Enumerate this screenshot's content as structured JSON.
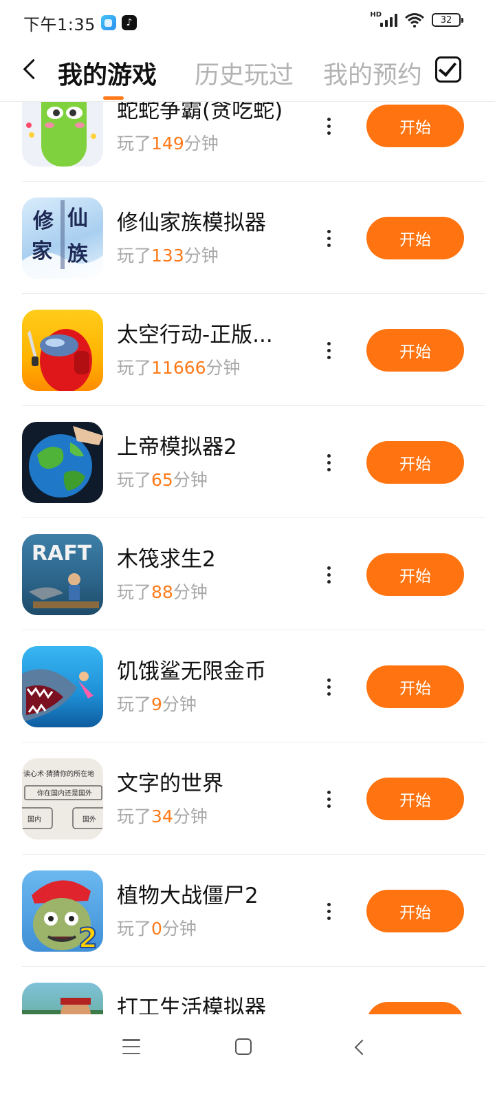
{
  "status_bar": {
    "time": "下午1:35",
    "hd_label": "HD",
    "battery": "32",
    "app_icons": [
      "message-app-icon",
      "tiktok-icon"
    ]
  },
  "header": {
    "tabs": [
      {
        "label": "我的游戏",
        "active": true
      },
      {
        "label": "历史玩过",
        "active": false
      },
      {
        "label": "我的预约",
        "active": false
      }
    ],
    "accent_color": "#ff7a1a"
  },
  "games": [
    {
      "title": "蛇蛇争霸(贪吃蛇)",
      "played_prefix": "玩了",
      "minutes": "149",
      "played_suffix": "分钟",
      "button": "开始",
      "icon": "snake-game-icon"
    },
    {
      "title": "修仙家族模拟器",
      "played_prefix": "玩了",
      "minutes": "133",
      "played_suffix": "分钟",
      "button": "开始",
      "icon": "cultivation-game-icon",
      "icon_text": "修仙家族"
    },
    {
      "title": "太空行动-正版...",
      "played_prefix": "玩了",
      "minutes": "11666",
      "played_suffix": "分钟",
      "button": "开始",
      "icon": "space-crewmate-icon"
    },
    {
      "title": "上帝模拟器2",
      "played_prefix": "玩了",
      "minutes": "65",
      "played_suffix": "分钟",
      "button": "开始",
      "icon": "earth-globe-icon"
    },
    {
      "title": "木筏求生2",
      "played_prefix": "玩了",
      "minutes": "88",
      "played_suffix": "分钟",
      "button": "开始",
      "icon": "raft-game-icon",
      "icon_text": "RAFT"
    },
    {
      "title": "饥饿鲨无限金币",
      "played_prefix": "玩了",
      "minutes": "9",
      "played_suffix": "分钟",
      "button": "开始",
      "icon": "hungry-shark-icon"
    },
    {
      "title": "文字的世界",
      "played_prefix": "玩了",
      "minutes": "34",
      "played_suffix": "分钟",
      "button": "开始",
      "icon": "word-world-icon",
      "icon_lines": [
        "读心术·猜猜你的所在地",
        "你在国内还是国外",
        "国内",
        "国外"
      ]
    },
    {
      "title": "植物大战僵尸2",
      "played_prefix": "玩了",
      "minutes": "0",
      "played_suffix": "分钟",
      "button": "开始",
      "icon": "zombie-game-icon"
    },
    {
      "title": "打工生活模拟器",
      "played_prefix": "玩了",
      "minutes": "",
      "played_suffix": "",
      "button": "开始",
      "icon": "worker-life-icon"
    }
  ],
  "nav_bar": {
    "items": [
      "menu-icon",
      "home-icon",
      "back-icon"
    ]
  }
}
